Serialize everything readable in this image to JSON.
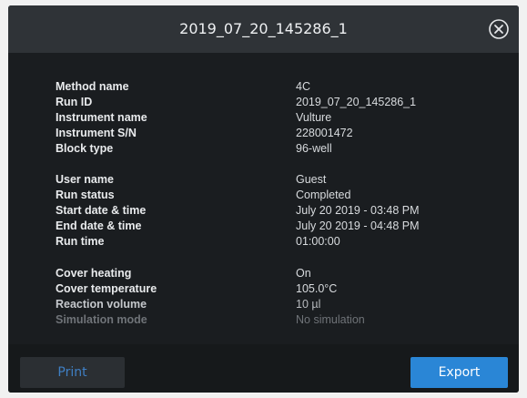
{
  "dialog": {
    "title": "2019_07_20_145286_1",
    "close_icon": "close-circle-icon"
  },
  "details": [
    {
      "label": "Method name",
      "value": "4C"
    },
    {
      "label": "Run ID",
      "value": "2019_07_20_145286_1"
    },
    {
      "label": "Instrument name",
      "value": "Vulture"
    },
    {
      "label": "Instrument S/N",
      "value": "228001472"
    },
    {
      "label": "Block type",
      "value": "96-well"
    },
    {
      "label": "User name",
      "value": "Guest"
    },
    {
      "label": "Run status",
      "value": "Completed"
    },
    {
      "label": "Start date & time",
      "value": "July 20 2019 - 03:48 PM"
    },
    {
      "label": "End date & time",
      "value": "July 20 2019 - 04:48 PM"
    },
    {
      "label": "Run time",
      "value": "01:00:00"
    },
    {
      "label": "Cover heating",
      "value": "On"
    },
    {
      "label": "Cover temperature",
      "value": "105.0°C"
    },
    {
      "label": "Reaction volume",
      "value": "10 µl"
    },
    {
      "label": "Simulation mode",
      "value": "No simulation"
    }
  ],
  "footer": {
    "print_label": "Print",
    "export_label": "Export"
  },
  "colors": {
    "export_button": "#2a86d6",
    "print_text": "#3f7fc4",
    "panel_bg": "#1e2124"
  }
}
